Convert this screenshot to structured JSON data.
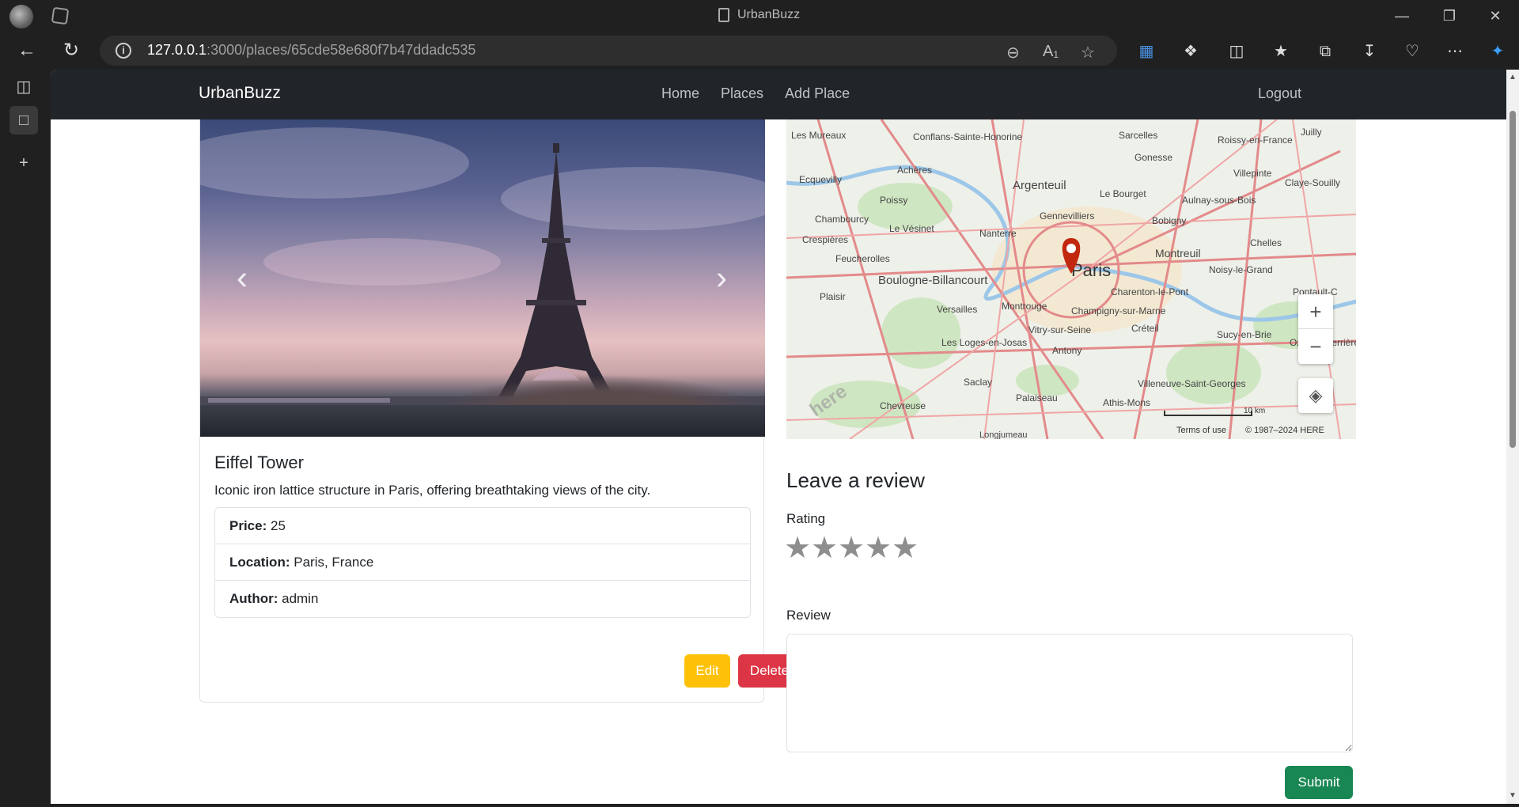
{
  "browser": {
    "tab_title": "UrbanBuzz",
    "url_host": "127.0.0.1",
    "url_rest": ":3000/places/65cde58e680f7b47ddadc535"
  },
  "navbar": {
    "brand": "UrbanBuzz",
    "links": [
      "Home",
      "Places",
      "Add Place"
    ],
    "logout": "Logout"
  },
  "place": {
    "title": "Eiffel Tower",
    "description": "Iconic iron lattice structure in Paris, offering breathtaking views of the city.",
    "price_label": "Price:",
    "price": "25",
    "location_label": "Location:",
    "location": "Paris, France",
    "author_label": "Author:",
    "author": "admin",
    "edit_label": "Edit",
    "delete_label": "Delete"
  },
  "map": {
    "city_label": "Paris",
    "places": [
      "Les Mureaux",
      "Conflans-Sainte-Honorine",
      "Sarcelles",
      "Roissy-en-France",
      "Juilly",
      "Ecquevilly",
      "Achères",
      "Argenteuil",
      "Gonesse",
      "Villepinte",
      "Claye-Souilly",
      "Poissy",
      "Le Bourget",
      "Aulnay-sous-Bois",
      "Chambourcy",
      "Le Vésinet",
      "Gennevilliers",
      "Bobigny",
      "Crespières",
      "Nanterre",
      "Montreuil",
      "Chelles",
      "Feucherolles",
      "Boulogne-Billancourt",
      "Noisy-le-Grand",
      "Plaisir",
      "Charenton-le-Pont",
      "Versailles",
      "Montrouge",
      "Champigny-sur-Marne",
      "Pontault-C",
      "Vitry-sur-Seine",
      "Créteil",
      "Sucy-en-Brie",
      "Les Loges-en-Josas",
      "Antony",
      "Ozoir-la-Ferrière",
      "Saclay",
      "Villeneuve-Saint-Georges",
      "Palaiseau",
      "Athis-Mons",
      "Chevreuse",
      "Longjumeau"
    ],
    "zoom_in": "+",
    "zoom_out": "−",
    "scale": "10 km",
    "terms": "Terms of use",
    "copyright": "© 1987–2024 HERE",
    "logo": "here"
  },
  "review": {
    "heading": "Leave a review",
    "rating_label": "Rating",
    "stars": 5,
    "rating_value": 0,
    "review_label": "Review",
    "review_value": "",
    "submit_label": "Submit"
  }
}
